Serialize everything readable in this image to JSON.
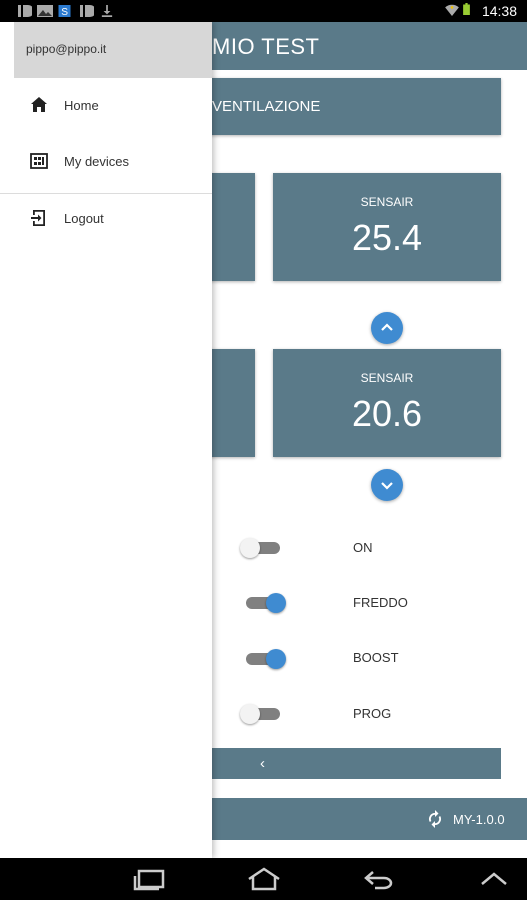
{
  "status_bar": {
    "time": "14:38",
    "left_icons": [
      "notification-icon",
      "image-icon",
      "s-app-icon",
      "notification-icon",
      "download-icon"
    ],
    "right_icons": [
      "wifi-icon",
      "battery-icon"
    ]
  },
  "app_bar": {
    "title": "MIO TEST"
  },
  "tab": {
    "label": "VENTILAZIONE"
  },
  "sensors": [
    {
      "label": "SENSAIR",
      "value": "25.4"
    },
    {
      "label": "SENSAIR",
      "value": "20.6"
    }
  ],
  "toggles": [
    {
      "label": "ON",
      "state": "off"
    },
    {
      "label": "FREDDO",
      "state": "on"
    },
    {
      "label": "BOOST",
      "state": "on"
    },
    {
      "label": "PROG",
      "state": "off"
    }
  ],
  "pager": {
    "prev_symbol": "‹"
  },
  "footer": {
    "version": "MY-1.0.0"
  },
  "drawer": {
    "email": "pippo@pippo.it",
    "items": [
      {
        "label": "Home",
        "icon": "home-icon"
      },
      {
        "label": "My devices",
        "icon": "devices-icon"
      },
      {
        "label": "Logout",
        "icon": "logout-icon"
      }
    ]
  },
  "nav_bar": {
    "buttons": [
      "recent-apps-icon",
      "home-nav-icon",
      "back-icon",
      "menu-up-icon"
    ]
  },
  "colors": {
    "primary": "#5a7a89",
    "accent": "#3f8bd1"
  }
}
